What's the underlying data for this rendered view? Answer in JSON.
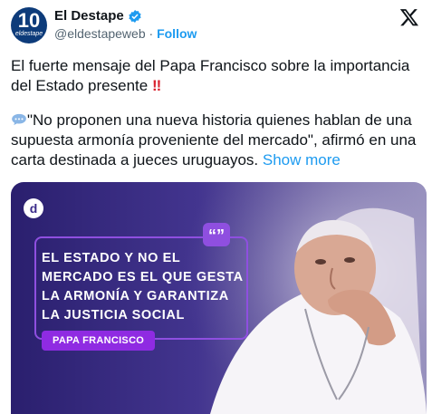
{
  "account": {
    "avatar_number": "10",
    "avatar_small": "eldestape",
    "name": "El Destape",
    "handle": "@eldestapeweb",
    "separator": "·",
    "follow_label": "Follow"
  },
  "tweet": {
    "line1": "El fuerte mensaje del Papa Francisco sobre la importancia del Estado presente",
    "emphasis": "!!",
    "body": "\"No proponen una nueva historia quienes hablan de una supuesta armonía proveniente del mercado\", afirmó en una carta destinada a jueces uruguayos.",
    "show_more": "Show more"
  },
  "media": {
    "logo_letter": "d",
    "quote_mark": "“”",
    "quote": "EL ESTADO Y NO EL MERCADO ES EL QUE GESTA LA ARMONÍA Y GARANTIZA LA JUSTICIA SOCIAL",
    "author": "PAPA FRANCISCO"
  },
  "colors": {
    "accent_blue": "#1d9bf0",
    "media_purple": "#8f4fe0",
    "bang_red": "#d9232f"
  },
  "icons": [
    "verified-badge-icon",
    "x-logo-icon",
    "speech-bubble-icon",
    "quote-icon"
  ]
}
